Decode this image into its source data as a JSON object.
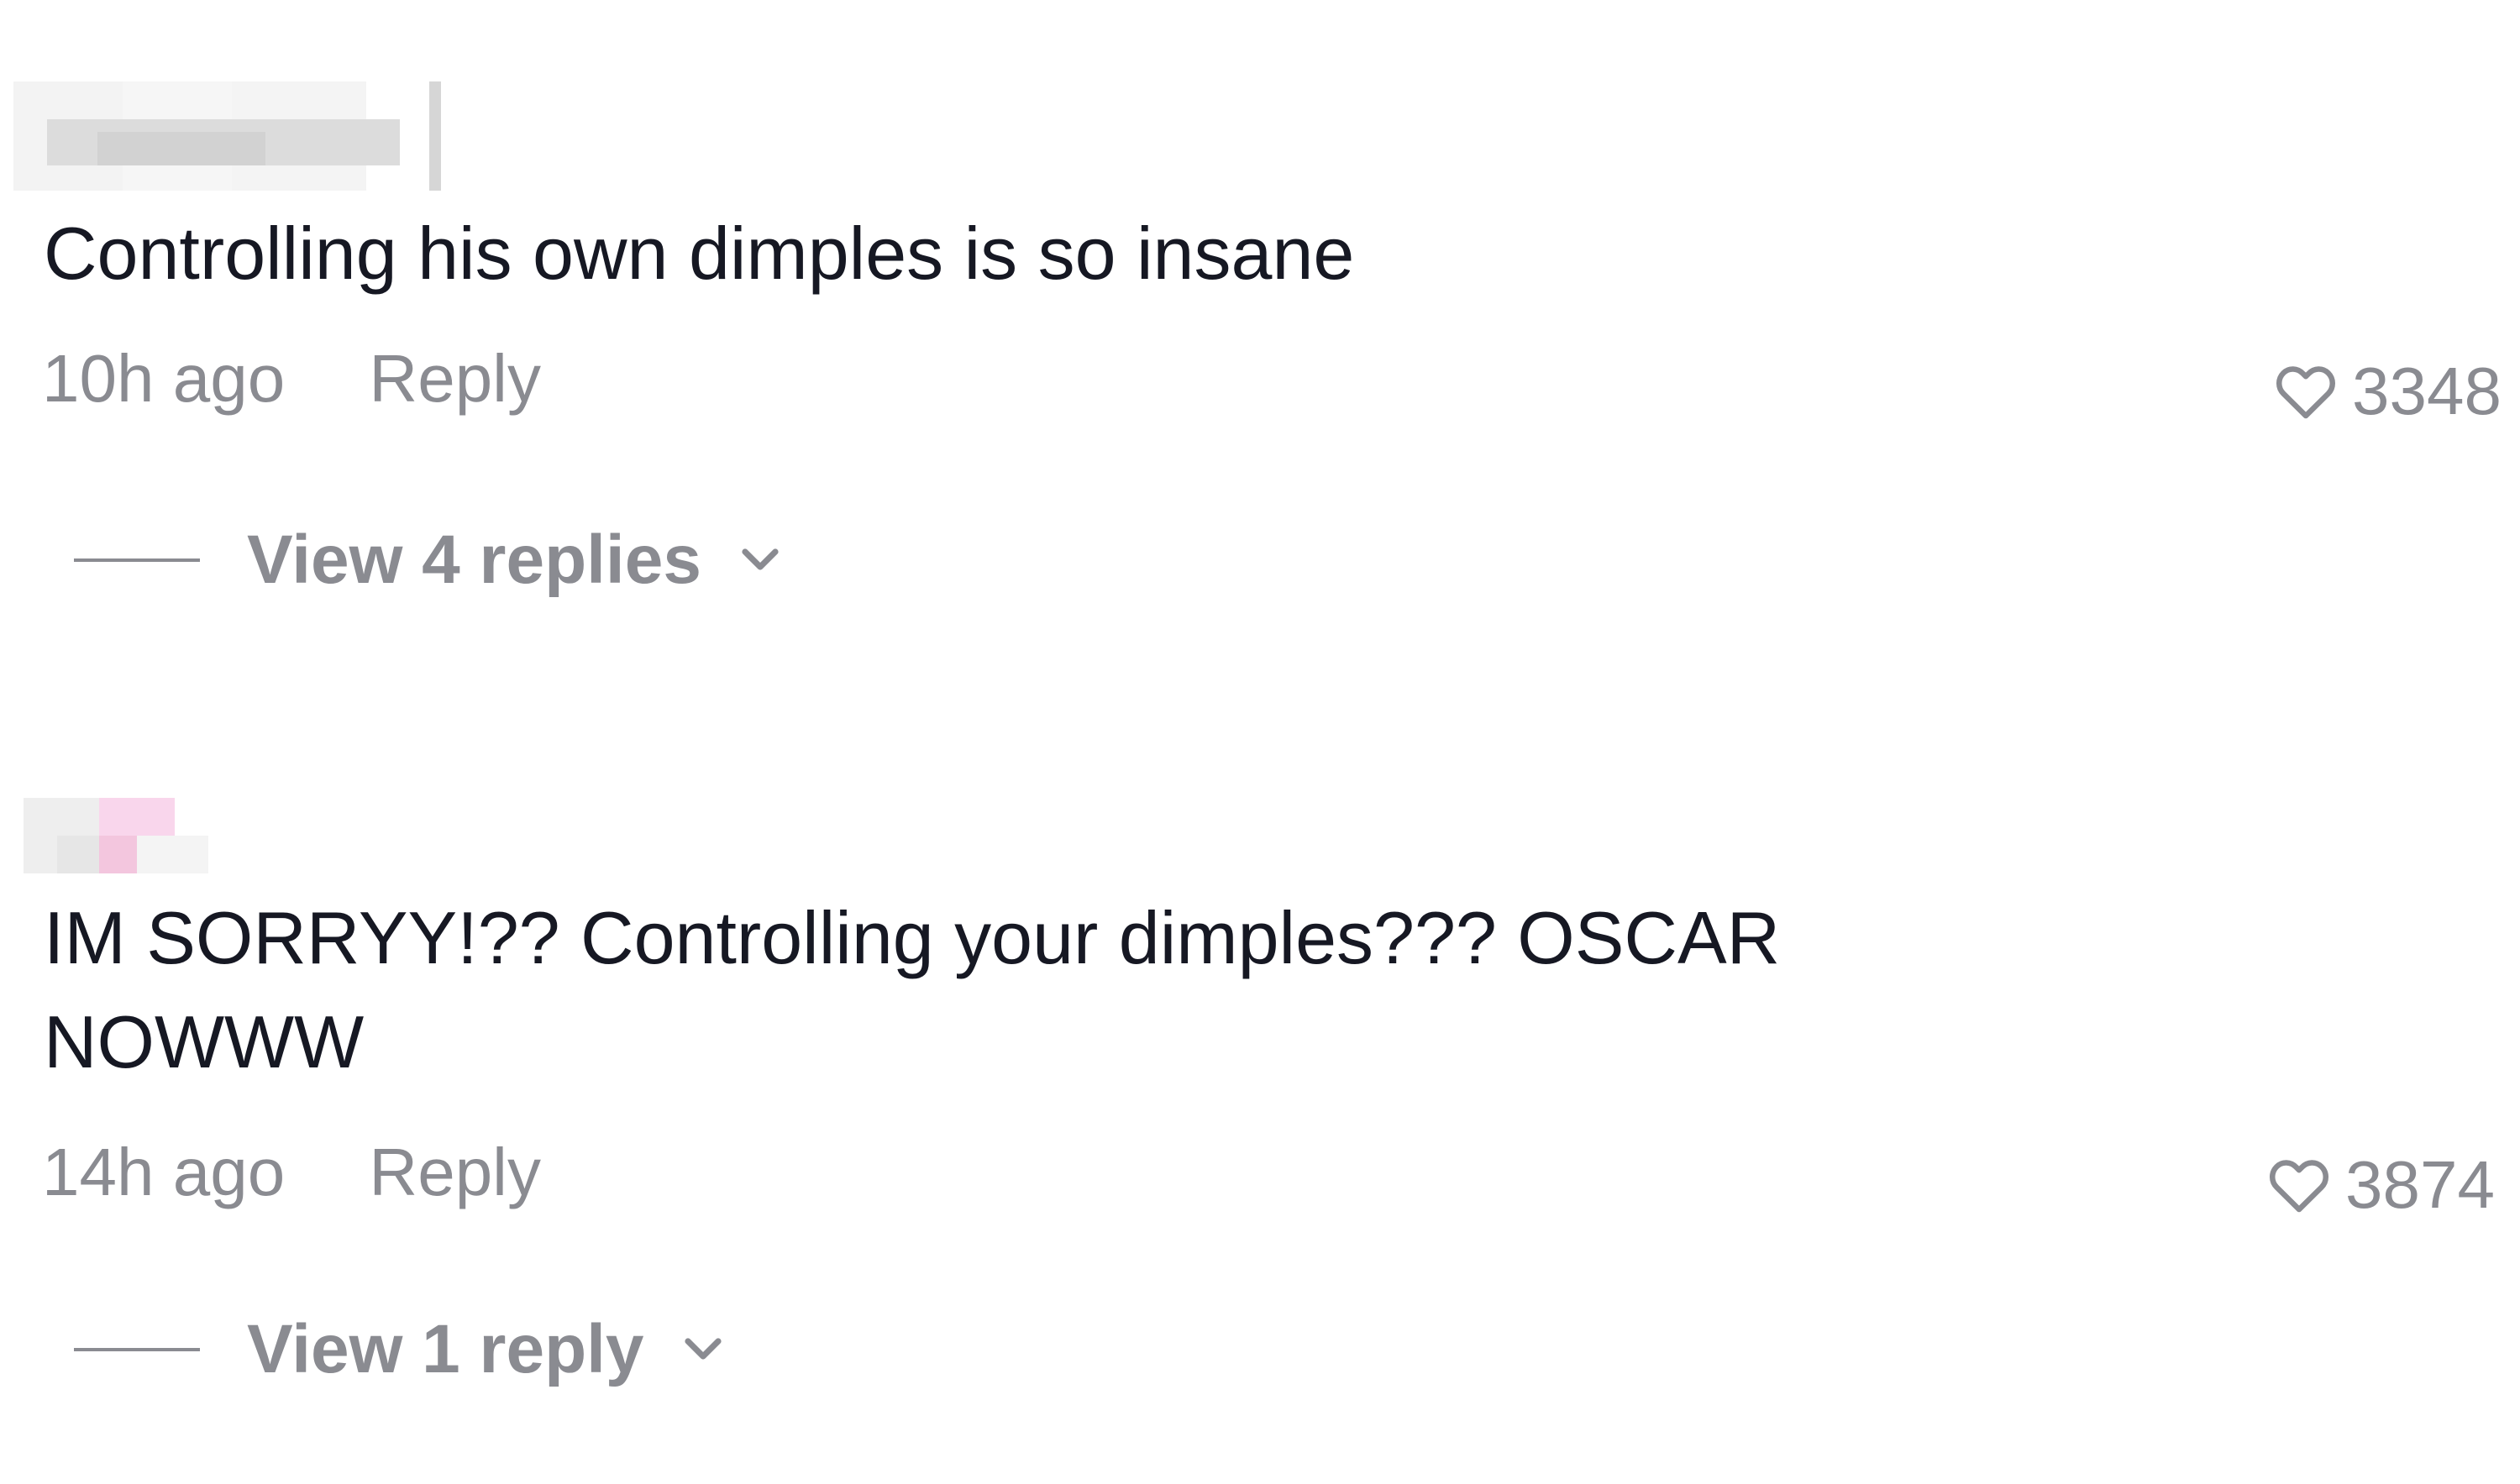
{
  "comments": [
    {
      "text": "Controlling his own dimples is so insane",
      "time": "10h ago",
      "reply_label": "Reply",
      "likes": "3348",
      "view_replies_label": "View 4 replies"
    },
    {
      "text": "IM SORRYY!?? Controlling your dimples??? OSCAR\nNOWWW",
      "time": "14h ago",
      "reply_label": "Reply",
      "likes": "3874",
      "view_replies_label": "View 1 reply"
    }
  ],
  "icons": {
    "like": "heart-outline-icon",
    "expand": "chevron-down-icon"
  },
  "colors": {
    "primary_text": "#161823",
    "secondary_text": "#8a8b91",
    "background": "#ffffff"
  }
}
